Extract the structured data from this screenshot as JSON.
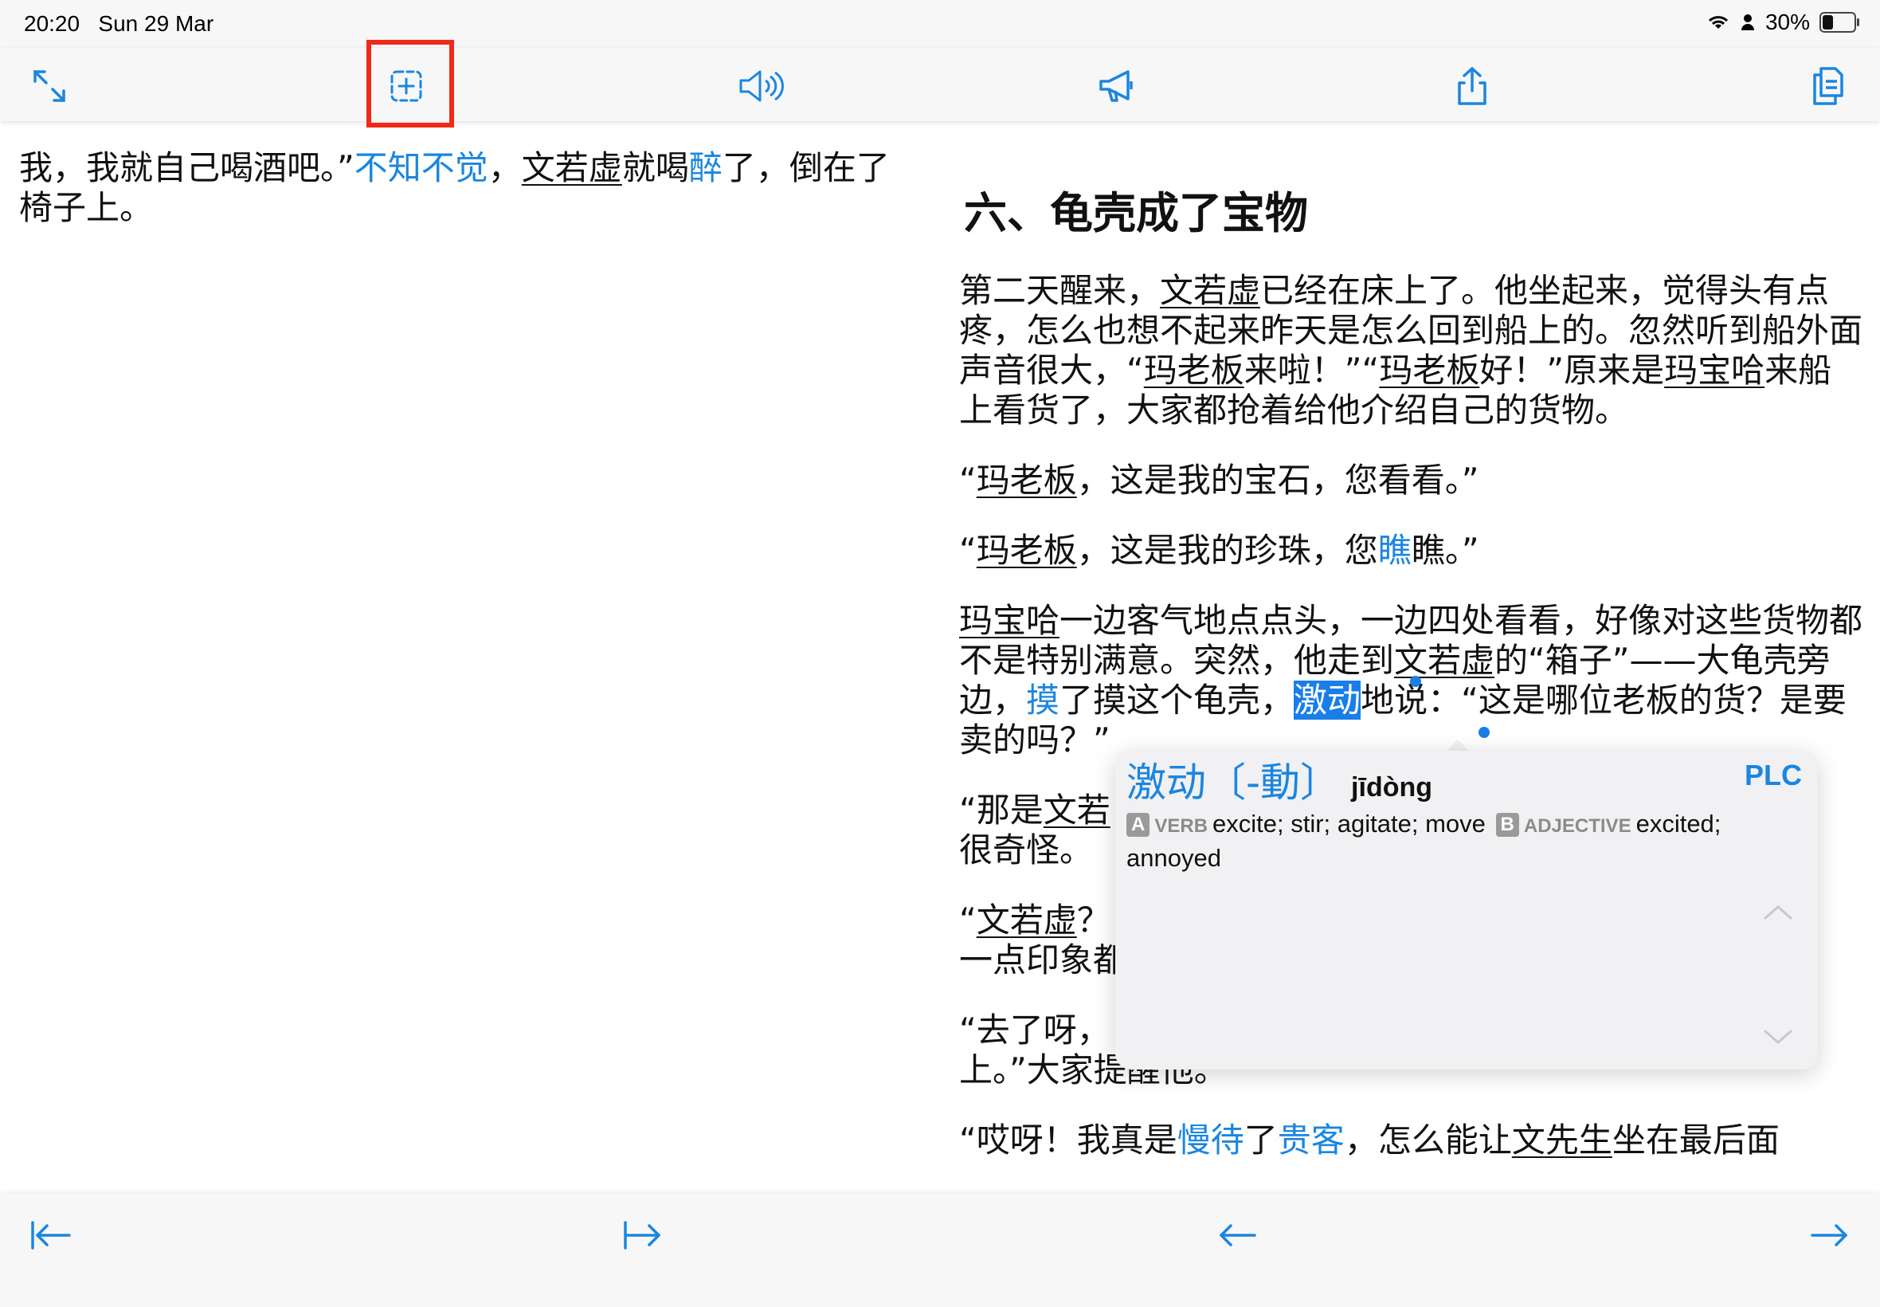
{
  "status": {
    "time": "20:20",
    "date": "Sun 29 Mar",
    "battery": "30%"
  },
  "toolbar": {
    "expand_icon": "expand-icon",
    "add_frame_icon": "add-frame-icon",
    "speaker_icon": "speaker-icon",
    "megaphone_icon": "megaphone-icon",
    "share_icon": "share-icon",
    "copy_icon": "copy-icon"
  },
  "left": {
    "line1_a": "我，我就自己喝酒吧。”",
    "line1_b": "不知不觉",
    "line1_c": "，",
    "line1_d": "文若虚",
    "line1_e": "就喝",
    "line1_f": "醉",
    "line1_g": "了，倒在了椅子上。"
  },
  "right": {
    "heading": "六、龟壳成了宝物",
    "p1": {
      "a": "第二天醒来，",
      "b": "文若虚",
      "c": "已经在床上了。他坐起来，觉得头有点疼，怎么也想不起来昨天是怎么回到船上的。忽然听到船外面声音很大，“",
      "d": "玛老板",
      "e": "来啦！”“",
      "f": "玛老板",
      "g": "好！”原来是",
      "h": "玛宝哈",
      "i": "来船上看货了，大家都抢着给他介绍自己的货物。"
    },
    "p2": {
      "a": "“",
      "b": "玛老板",
      "c": "，这是我的宝石，您看看。”"
    },
    "p3": {
      "a": "“",
      "b": "玛老板",
      "c": "，这是我的珍珠，您",
      "d": "瞧",
      "e": "瞧。”"
    },
    "p4": {
      "a": "玛宝哈",
      "b": "一边客气地点点头，一边四处看看，好像对这些货物都不是特别满意。突然，他走到",
      "c": "文若虚",
      "d": "的“箱子”——大龟壳旁边，",
      "e": "摸",
      "f": "了摸这个龟壳，",
      "g": "激动",
      "h": "地说：“这是哪位老板的货？是要卖的吗？”"
    },
    "p5": {
      "a": "“那是",
      "b": "文若",
      "c": "",
      "d": "很奇怪。"
    },
    "p6": {
      "a": "“",
      "b": "文若虚",
      "c": "？",
      "d": "一点印象都"
    },
    "p7": {
      "a": "“去了呀，",
      "b": "上。”大家提醒他。"
    },
    "p8": {
      "a": "“哎呀！我真是",
      "b": "慢待",
      "c": "了",
      "d": "贵客",
      "e": "，怎么能让",
      "f": "文先生",
      "g": "坐在最后面"
    }
  },
  "popup": {
    "word": "激动",
    "traditional": "〔-動〕",
    "pinyin": "jīdòng",
    "source": "PLC",
    "tag_a": "A",
    "pos_a": "VERB",
    "def_a": "excite; stir; agitate; move",
    "tag_b": "B",
    "pos_b": "ADJECTIVE",
    "def_b": "excited; annoyed"
  },
  "bottombar": {
    "first_icon": "arrow-to-left-bar-icon",
    "last_icon": "arrow-to-right-bar-icon",
    "prev_icon": "arrow-left-icon",
    "next_icon": "arrow-right-icon"
  },
  "colors": {
    "accent": "#1a86e0",
    "highlight_box": "#f02a17",
    "selection": "#1a7ee8"
  }
}
